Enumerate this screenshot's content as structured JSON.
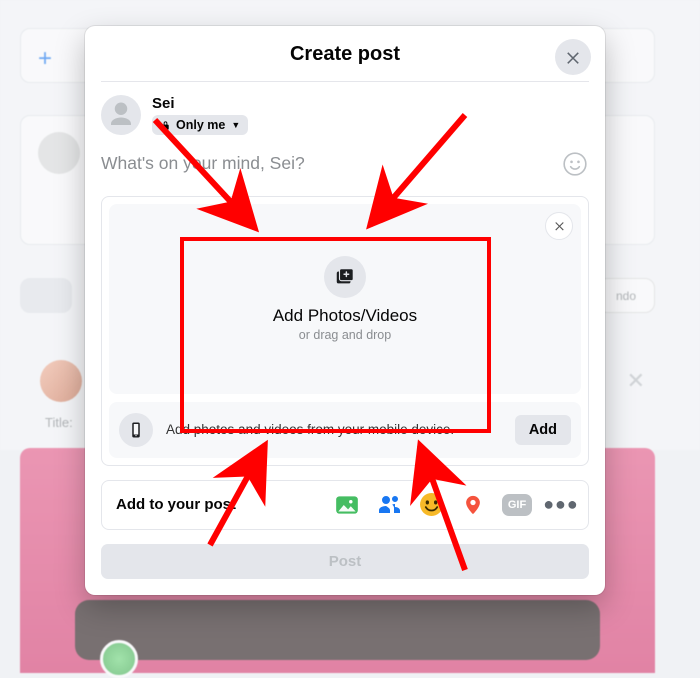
{
  "header": {
    "title": "Create post"
  },
  "user": {
    "name": "Sei",
    "privacy_label": "Only me"
  },
  "compose": {
    "placeholder": "What's on your mind, Sei?"
  },
  "upload": {
    "title": "Add Photos/Videos",
    "subtitle": "or drag and drop"
  },
  "mobile": {
    "text": "Add photos and videos from your mobile device.",
    "button": "Add"
  },
  "addto": {
    "label": "Add to your post",
    "gif_label": "GIF",
    "more": "●●●"
  },
  "post_button": "Post",
  "background": {
    "title_label": "Title:",
    "undo_label": "ndo"
  }
}
